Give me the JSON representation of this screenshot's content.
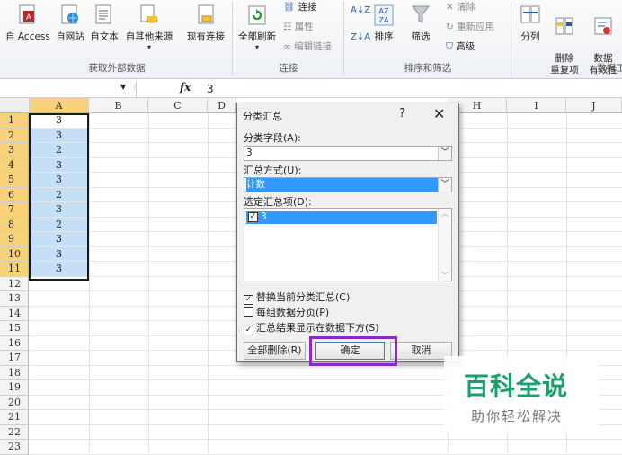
{
  "ribbon": {
    "get_external": [
      {
        "label": "自 Access",
        "icon": "access-db-icon"
      },
      {
        "label": "自网站",
        "icon": "web-globe-icon"
      },
      {
        "label": "自文本",
        "icon": "text-file-icon"
      },
      {
        "label": "自其他来源",
        "icon": "other-source-icon"
      },
      {
        "label": "现有连接",
        "icon": "existing-connection-icon"
      }
    ],
    "get_external_group": "获取外部数据",
    "refresh_all": "全部刷新",
    "connections": "连接",
    "properties": "属性",
    "edit_links": "编辑链接",
    "connections_group": "连接",
    "sort": "排序",
    "filter": "筛选",
    "clear": "清除",
    "reapply": "重新应用",
    "advanced": "高级",
    "sort_filter_group": "排序和筛选",
    "text_to_columns": "分列",
    "remove_duplicates": "删除\n重复项",
    "data_validation": "数据\n有效性",
    "data_tools_group": "数据工"
  },
  "formula_bar": {
    "fx": "fx",
    "value": "3"
  },
  "columns": [
    "A",
    "B",
    "C",
    "D",
    "H",
    "I",
    "J"
  ],
  "rows": [
    "1",
    "2",
    "3",
    "4",
    "5",
    "6",
    "7",
    "8",
    "9",
    "10",
    "11",
    "12",
    "13",
    "14",
    "15",
    "16",
    "17",
    "18",
    "19",
    "20",
    "21",
    "22",
    "23"
  ],
  "col_a_values": [
    "3",
    "3",
    "2",
    "3",
    "3",
    "2",
    "3",
    "2",
    "3",
    "3",
    "3"
  ],
  "dialog": {
    "title": "分类汇总",
    "help": "?",
    "close": "✕",
    "group_by_label": "分类字段(A):",
    "group_by_value": "3",
    "function_label": "汇总方式(U):",
    "function_value": "计数",
    "add_to_label": "选定汇总项(D):",
    "add_to_item": "3",
    "replace_current": "替换当前分类汇总(C)",
    "page_break": "每组数据分页(P)",
    "summary_below": "汇总结果显示在数据下方(S)",
    "remove_all": "全部删除(R)",
    "ok": "确定",
    "cancel": "取消"
  },
  "watermark": {
    "title": "百科全说",
    "subtitle": "助你轻松解决"
  }
}
